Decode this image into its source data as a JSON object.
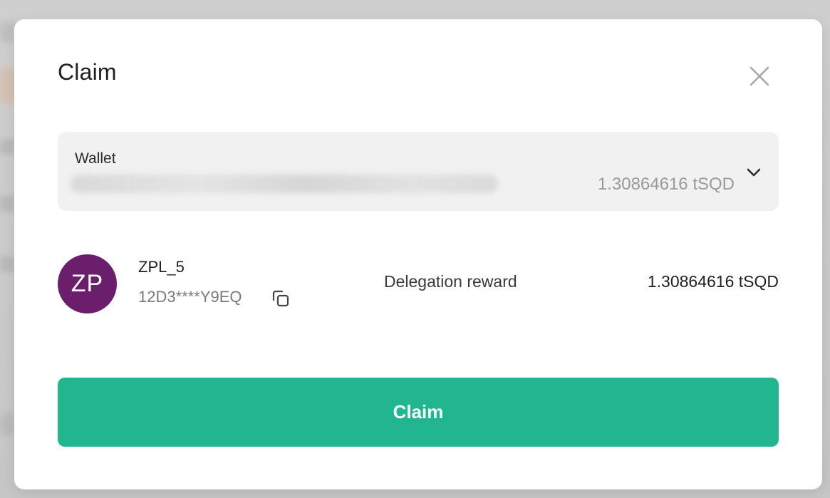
{
  "modal": {
    "title": "Claim",
    "close_icon": "close-icon"
  },
  "wallet": {
    "label": "Wallet",
    "balance": "1.30864616 tSQD",
    "dropdown_icon": "chevron-down-icon"
  },
  "worker": {
    "avatar_initials": "ZP",
    "avatar_color": "#6a1e6b",
    "name": "ZPL_5",
    "peer_id": "12D3****Y9EQ",
    "copy_icon": "copy-icon",
    "reward_label": "Delegation reward",
    "reward_value": "1.30864616 tSQD"
  },
  "actions": {
    "claim_label": "Claim",
    "claim_color": "#21b68f"
  }
}
